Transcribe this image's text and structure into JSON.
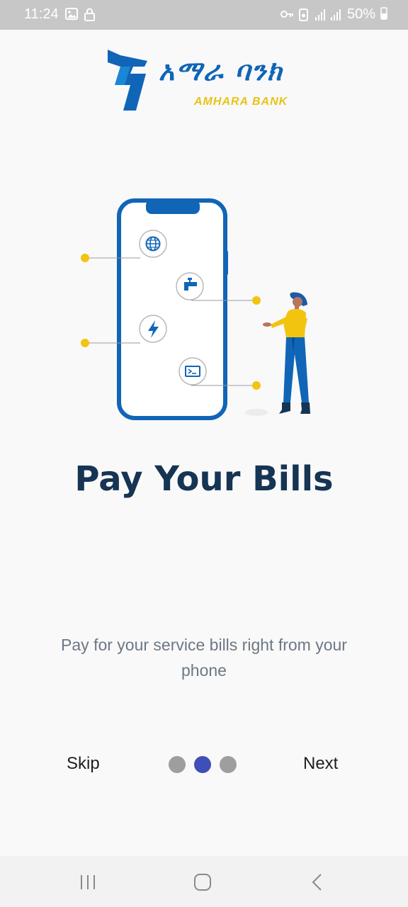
{
  "status_bar": {
    "time": "11:24",
    "battery_text": "50%"
  },
  "logo": {
    "amharic": "አማራ ባንክ",
    "english": "AMHARA BANK"
  },
  "onboarding": {
    "title": "Pay Your Bills",
    "description": "Pay for your service bills right from your phone",
    "skip_label": "Skip",
    "next_label": "Next",
    "page_count": 3,
    "current_page": 2
  },
  "colors": {
    "brand_blue": "#1065b7",
    "brand_yellow": "#e8c316",
    "dot_active": "#3f4fb7",
    "dot_inactive": "#9e9e9e",
    "title": "#163453"
  },
  "illustration_icons": [
    "globe-icon",
    "water-tap-icon",
    "lightning-icon",
    "ticket-icon"
  ]
}
